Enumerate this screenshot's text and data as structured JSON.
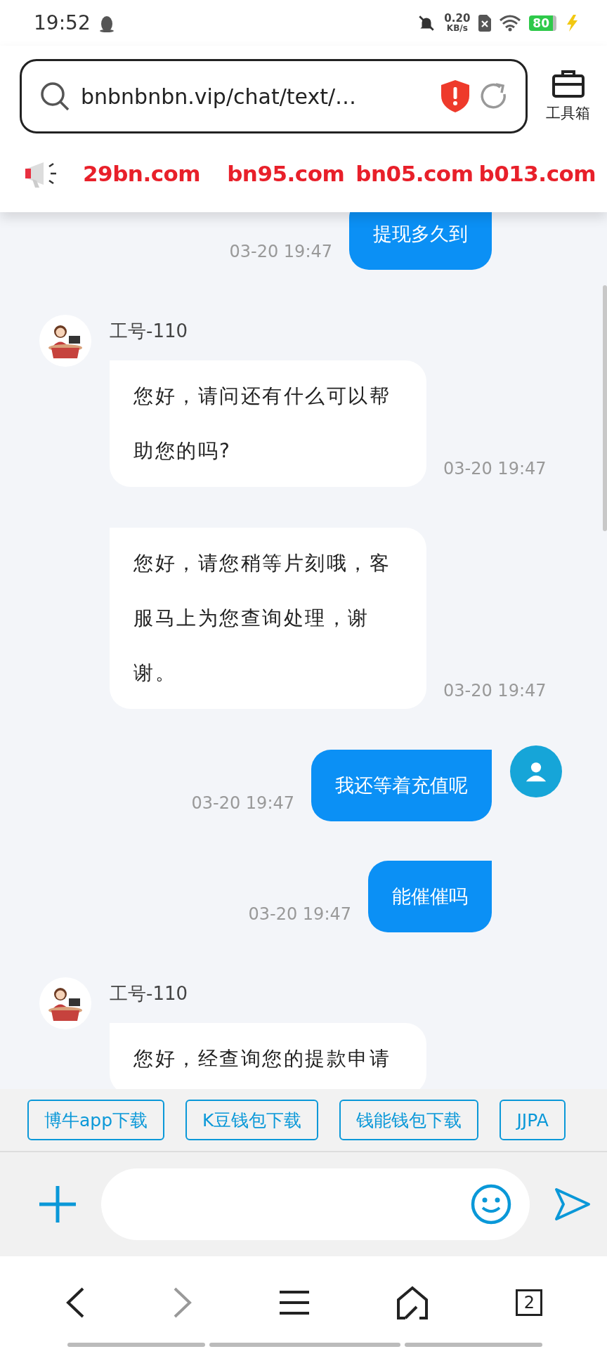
{
  "status_bar": {
    "time": "19:52",
    "network_speed": "0.20",
    "network_unit": "KB/s",
    "battery": "80",
    "charging": true
  },
  "address_bar": {
    "url": "bnbnbnbn.vip/chat/text/…",
    "toolbox_label": "工具箱"
  },
  "ticker": {
    "links": [
      "29bn.com",
      "bn95.com",
      "bn05.com",
      "b013.com"
    ]
  },
  "messages": [
    {
      "kind": "sent",
      "text": "提现多久到",
      "time": "03-20 19:47",
      "avatar": false
    },
    {
      "kind": "received",
      "sender": "工号-110",
      "text": "您好，请问还有什么可以帮助您的吗?",
      "time": "03-20 19:47"
    },
    {
      "kind": "received",
      "text": "您好，请您稍等片刻哦，客服马上为您查询处理，谢谢。",
      "time": "03-20 19:47"
    },
    {
      "kind": "sent",
      "text": "我还等着充值呢",
      "time": "03-20 19:47",
      "avatar": true
    },
    {
      "kind": "sent",
      "text": "能催催吗",
      "time": "03-20 19:47",
      "avatar": false
    },
    {
      "kind": "received",
      "sender": "工号-110",
      "text": "您好，经查询您的提款申请"
    }
  ],
  "quick_links": [
    "博牛app下载",
    "K豆钱包下载",
    "钱能钱包下载",
    "JJPA"
  ],
  "nav": {
    "forward_disabled": true,
    "tab_count": "2"
  }
}
